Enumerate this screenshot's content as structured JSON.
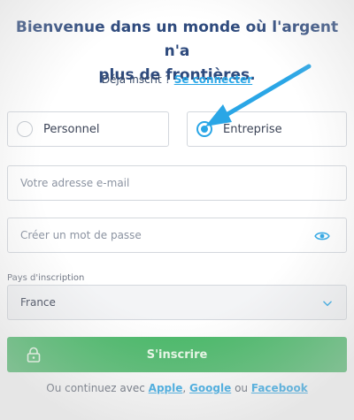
{
  "heading": {
    "line1": "Bienvenue dans un monde où l'argent n'a",
    "line2": "plus de frontières."
  },
  "signin": {
    "prompt": "Déjà inscrit ?",
    "link": "Se connecter"
  },
  "account_type": {
    "options": [
      {
        "label": "Personnel",
        "checked": false
      },
      {
        "label": "Entreprise",
        "checked": true
      }
    ]
  },
  "email": {
    "placeholder": "Votre adresse e-mail",
    "value": ""
  },
  "password": {
    "placeholder": "Créer un mot de passe",
    "value": ""
  },
  "country": {
    "label": "Pays d'inscription",
    "value": "France"
  },
  "submit": {
    "label": "S'inscrire"
  },
  "alternatives": {
    "prefix": "Ou continuez avec",
    "apple": "Apple",
    "google": "Google",
    "separator": "ou",
    "facebook": "Facebook"
  },
  "colors": {
    "accent": "#2aa6e6",
    "primary_button": "#46b866",
    "heading": "#2e4a7d"
  },
  "icons": {
    "password_toggle": "eye-icon",
    "country_dropdown": "chevron-down-icon",
    "submit": "lock-icon",
    "annotation": "arrow-annotation"
  }
}
